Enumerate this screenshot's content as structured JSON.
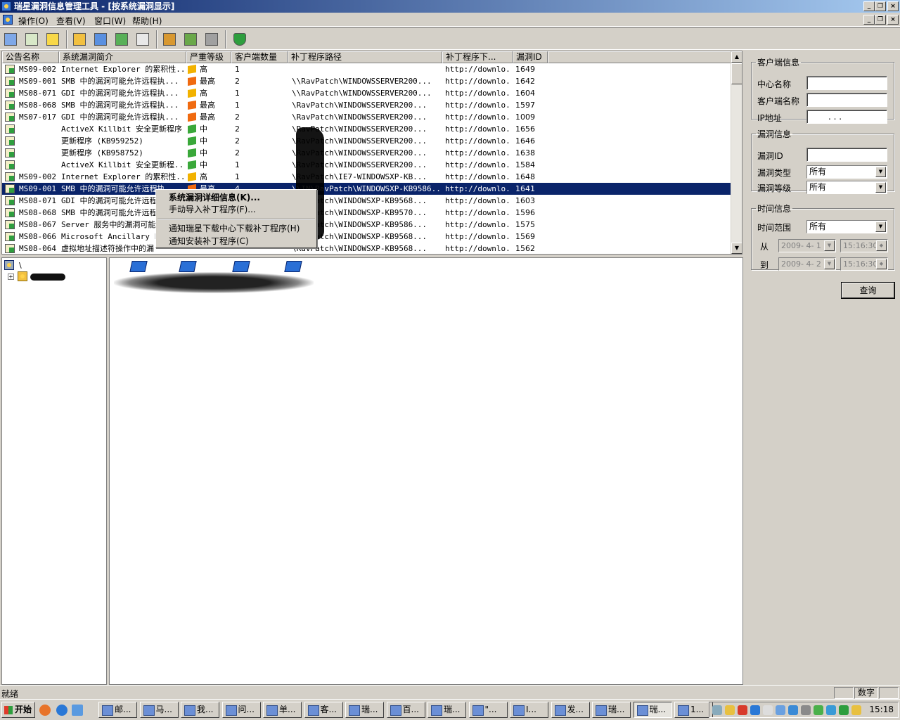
{
  "window": {
    "title": "瑞星漏洞信息管理工具 - [按系统漏洞显示]"
  },
  "menu": [
    "操作(O)",
    "查看(V)",
    "窗口(W)",
    "帮助(H)"
  ],
  "icons": {
    "app": "app-shield-icon",
    "tree_root": "network-icon",
    "tree_node": "user-group-icon"
  },
  "table": {
    "columns": [
      "公告名称",
      "系统漏洞简介",
      "严重等级",
      "客户端数量",
      "补丁程序路径",
      "补丁程序下...",
      "漏洞ID"
    ],
    "rows": [
      {
        "bulletin": "MS09-002",
        "summary": "Internet Explorer 的累积性...",
        "severity": "高",
        "clients": "1",
        "path": "",
        "dl": "http://downlo...",
        "id": "1649"
      },
      {
        "bulletin": "MS09-001",
        "summary": "SMB 中的漏洞可能允许远程执...",
        "severity": "最高",
        "clients": "2",
        "path": "\\\\RavPatch\\WINDOWSSERVER200...",
        "dl": "http://downlo...",
        "id": "1642"
      },
      {
        "bulletin": "MS08-071",
        "summary": "GDI 中的漏洞可能允许远程执...",
        "severity": "高",
        "clients": "1",
        "path": "\\\\RavPatch\\WINDOWSSERVER200...",
        "dl": "http://downlo...",
        "id": "1604"
      },
      {
        "bulletin": "MS08-068",
        "summary": "SMB 中的漏洞可能允许远程执...",
        "severity": "最高",
        "clients": "1",
        "path": "\\RavPatch\\WINDOWSSERVER200...",
        "dl": "http://downlo...",
        "id": "1597"
      },
      {
        "bulletin": "MS07-017",
        "summary": "GDI 中的漏洞可能允许远程执...",
        "severity": "最高",
        "clients": "2",
        "path": "\\RavPatch\\WINDOWSSERVER200...",
        "dl": "http://downlo...",
        "id": "1009"
      },
      {
        "bulletin": "",
        "summary": "ActiveX Killbit 安全更新程序",
        "severity": "中",
        "clients": "2",
        "path": "\\RavPatch\\WINDOWSSERVER200...",
        "dl": "http://downlo...",
        "id": "1656"
      },
      {
        "bulletin": "",
        "summary": "更新程序 (KB959252)",
        "severity": "中",
        "clients": "2",
        "path": "\\RavPatch\\WINDOWSSERVER200...",
        "dl": "http://downlo...",
        "id": "1646"
      },
      {
        "bulletin": "",
        "summary": "更新程序 (KB958752)",
        "severity": "中",
        "clients": "2",
        "path": "\\RavPatch\\WINDOWSSERVER200...",
        "dl": "http://downlo...",
        "id": "1638"
      },
      {
        "bulletin": "",
        "summary": "ActiveX Killbit 安全更新程...",
        "severity": "中",
        "clients": "1",
        "path": "\\RavPatch\\WINDOWSSERVER200...",
        "dl": "http://downlo...",
        "id": "1584"
      },
      {
        "bulletin": "MS09-002",
        "summary": "Internet Explorer 的累积性...",
        "severity": "高",
        "clients": "1",
        "path": "\\RavPatch\\IE7-WINDOWSXP-KB...",
        "dl": "http://downlo...",
        "id": "1648"
      },
      {
        "bulletin": "MS09-001",
        "summary": "SMB 中的漏洞可能允许远程执...",
        "severity": "最高",
        "clients": "4",
        "path": "\\\\IN\\RavPatch\\WINDOWSXP-KB9586...",
        "dl": "http://downlo...",
        "id": "1641"
      },
      {
        "bulletin": "MS08-071",
        "summary": "GDI 中的漏洞可能允许远程",
        "severity": "",
        "clients": "",
        "path": "\\RavPatch\\WINDOWSXP-KB9568...",
        "dl": "http://downlo...",
        "id": "1603"
      },
      {
        "bulletin": "MS08-068",
        "summary": "SMB 中的漏洞可能允许远程",
        "severity": "",
        "clients": "",
        "path": "\\RavPatch\\WINDOWSXP-KB9570...",
        "dl": "http://downlo...",
        "id": "1596"
      },
      {
        "bulletin": "MS08-067",
        "summary": "Server 服务中的漏洞可能",
        "severity": "",
        "clients": "",
        "path": "\\RavPatch\\WINDOWSXP-KB9586...",
        "dl": "http://downlo...",
        "id": "1575"
      },
      {
        "bulletin": "MS08-066",
        "summary": "Microsoft Ancillary Fu",
        "severity": "",
        "clients": "",
        "path": "\\RavPatch\\WINDOWSXP-KB9568...",
        "dl": "http://downlo...",
        "id": "1569"
      },
      {
        "bulletin": "MS08-064",
        "summary": "虚拟地址描述符操作中的漏",
        "severity": "",
        "clients": "",
        "path": "\\RavPatch\\WINDOWSXP-KB9568...",
        "dl": "http://downlo...",
        "id": "1562"
      }
    ],
    "selected_row": 10,
    "severity_colors": {
      "高": "#f2b200",
      "最高": "#f06a10",
      "中": "#3aa83a"
    }
  },
  "context_menu": {
    "items": [
      "系统漏洞详细信息(K)...",
      "手动导入补丁程序(F)...",
      "通知瑞星下载中心下载补丁程序(H)",
      "通知安装补丁程序(C)"
    ]
  },
  "tree": {
    "root": "\\"
  },
  "filters": {
    "client": {
      "legend": "客户端信息",
      "center_label": "中心名称",
      "client_label": "客户端名称",
      "ip_label": "IP地址",
      "ip_value": ".   .   ."
    },
    "vuln": {
      "legend": "漏洞信息",
      "id_label": "漏洞ID",
      "type_label": "漏洞类型",
      "type_value": "所有",
      "level_label": "漏洞等级",
      "level_value": "所有"
    },
    "time": {
      "legend": "时间信息",
      "range_label": "时间范围",
      "range_value": "所有",
      "from_label": "从",
      "from_date": "2009- 4- 1",
      "from_time": "15:16:30",
      "to_label": "到",
      "to_date": "2009- 4- 2",
      "to_time": "15:16:30"
    },
    "query_label": "查询"
  },
  "status": {
    "text": "就绪",
    "numlock": "数字"
  },
  "taskbar": {
    "start": "开始",
    "tasks": [
      "邮...",
      "马...",
      "我...",
      "问...",
      "单...",
      "客...",
      "瑞...",
      "百...",
      "瑞...",
      "\"...",
      "I...",
      "发...",
      "瑞...",
      "瑞...",
      "1..."
    ],
    "active_task": 13,
    "clock": "15:18"
  }
}
